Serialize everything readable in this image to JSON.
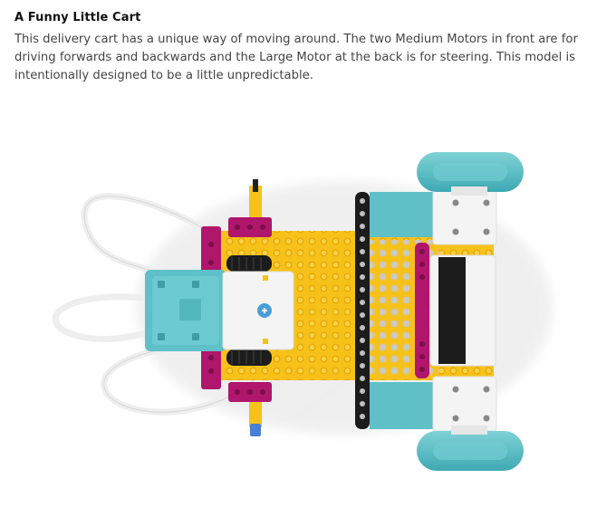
{
  "card": {
    "title": "A Funny Little Cart",
    "description": "This delivery cart has a unique way of moving around. The two Medium Motors in front are for driving forwards and backwards and the Large Motor at the back is for steering. This model is intentionally designed to be a little unpredictable."
  },
  "image": {
    "subject": "lego-cart-top-view",
    "colors": {
      "yellow": "#f6c21a",
      "magenta": "#b0166b",
      "teal": "#5fc0c8",
      "white": "#f4f4f4",
      "black": "#1c1c1c"
    }
  }
}
